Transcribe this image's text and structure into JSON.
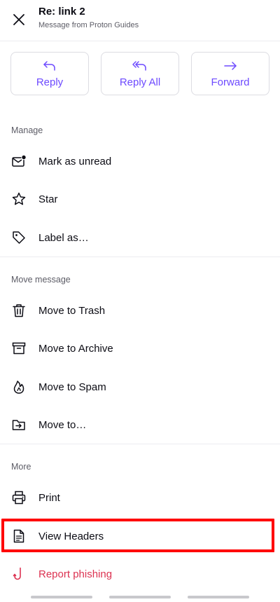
{
  "header": {
    "title": "Re: link 2",
    "subtitle": "Message from Proton Guides"
  },
  "actions": [
    {
      "label": "Reply",
      "icon": "reply-icon"
    },
    {
      "label": "Reply All",
      "icon": "reply-all-icon"
    },
    {
      "label": "Forward",
      "icon": "forward-icon"
    }
  ],
  "sections": {
    "manage": {
      "label": "Manage",
      "items": [
        {
          "label": "Mark as unread",
          "icon": "envelope-unread-icon"
        },
        {
          "label": "Star",
          "icon": "star-icon"
        },
        {
          "label": "Label as…",
          "icon": "tag-icon"
        }
      ]
    },
    "move": {
      "label": "Move message",
      "items": [
        {
          "label": "Move to Trash",
          "icon": "trash-icon"
        },
        {
          "label": "Move to Archive",
          "icon": "archive-icon"
        },
        {
          "label": "Move to Spam",
          "icon": "fire-icon"
        },
        {
          "label": "Move to…",
          "icon": "folder-move-icon"
        }
      ]
    },
    "more": {
      "label": "More",
      "items": [
        {
          "label": "Print",
          "icon": "printer-icon"
        },
        {
          "label": "View Headers",
          "icon": "document-icon"
        },
        {
          "label": "Report phishing",
          "icon": "hook-icon"
        }
      ]
    }
  },
  "colors": {
    "accent": "#6d4aff",
    "danger": "#dc3251",
    "highlight": "#ff0000",
    "text": "#0c0c14",
    "muted": "#5c5c66"
  }
}
